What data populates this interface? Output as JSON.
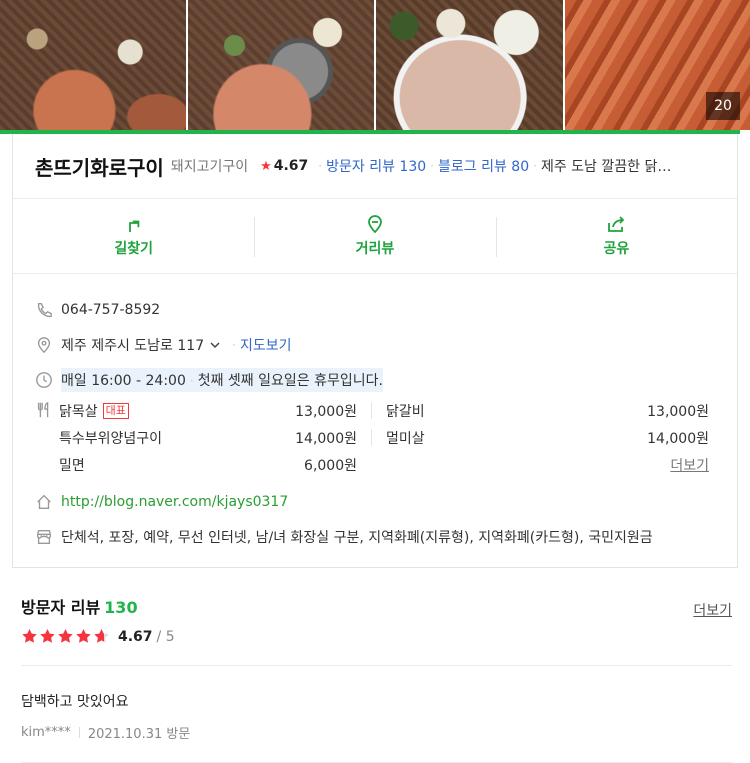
{
  "photos": {
    "count": "20"
  },
  "header": {
    "name": "촌뜨기화로구이",
    "category": "돼지고기구이",
    "star": "★",
    "rating": "4.67",
    "visitor_reviews": "방문자 리뷰 130",
    "blog_reviews": "블로그 리뷰 80",
    "description": "제주 도남 깔끔한 닭…"
  },
  "actions": [
    {
      "label": "길찾기",
      "icon": "directions-icon"
    },
    {
      "label": "거리뷰",
      "icon": "street-view-icon"
    },
    {
      "label": "공유",
      "icon": "share-icon"
    }
  ],
  "info": {
    "phone": "064-757-8592",
    "address": "제주 제주시 도남로 117",
    "map_link": "지도보기",
    "hours": "매일 16:00 - 24:00",
    "hours_note": "첫째 셋째 일요일은 휴무입니다.",
    "url": "http://blog.naver.com/kjays0317",
    "amenities": "단체석, 포장, 예약, 무선 인터넷, 남/녀 화장실 구분, 지역화폐(지류형), 지역화폐(카드형), 국민지원금"
  },
  "menu": {
    "badge": "대표",
    "items": [
      {
        "name": "닭목살",
        "price": "13,000원"
      },
      {
        "name": "닭갈비",
        "price": "13,000원"
      },
      {
        "name": "특수부위양념구이",
        "price": "14,000원"
      },
      {
        "name": "멀미살",
        "price": "14,000원"
      },
      {
        "name": "밀면",
        "price": "6,000원"
      }
    ],
    "more": "더보기"
  },
  "reviews": {
    "title": "방문자 리뷰",
    "count": "130",
    "more": "더보기",
    "rating": "4.67",
    "out_of": "/ 5",
    "stars_value": 4.67,
    "first": {
      "body": "담백하고 맛있어요",
      "author": "kim****",
      "date": "2021.10.31 방문"
    }
  },
  "colors": {
    "accent": "#1fb54a",
    "link": "#3366cc",
    "star": "#f6343f"
  }
}
